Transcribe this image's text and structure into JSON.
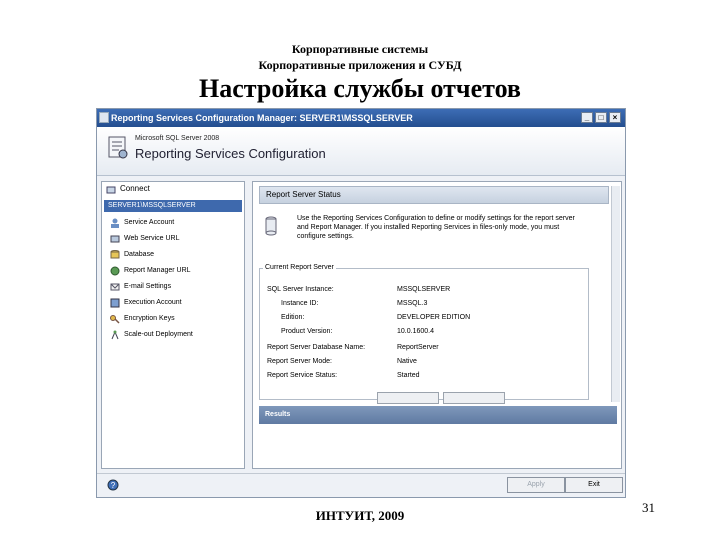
{
  "slide": {
    "header_line1": "Корпоративные системы",
    "header_line2": "Корпоративные приложения и СУБД",
    "title": "Настройка службы отчетов",
    "footer": "ИНТУИТ, 2009",
    "page_number": "31"
  },
  "window": {
    "title": "Reporting Services Configuration Manager: SERVER1\\MSSQLSERVER",
    "controls": [
      "_",
      "□",
      "×"
    ]
  },
  "banner": {
    "subtitle": "Microsoft SQL Server 2008",
    "title": "Reporting Services Configuration"
  },
  "sidebar": {
    "connect_label": "Connect",
    "server_label": "SERVER1\\MSSQLSERVER",
    "items": [
      {
        "label": "Service Account",
        "icon": "service-account-icon"
      },
      {
        "label": "Web Service URL",
        "icon": "web-service-icon"
      },
      {
        "label": "Database",
        "icon": "database-icon"
      },
      {
        "label": "Report Manager URL",
        "icon": "globe-icon"
      },
      {
        "label": "E-mail Settings",
        "icon": "email-icon"
      },
      {
        "label": "Execution Account",
        "icon": "execution-account-icon"
      },
      {
        "label": "Encryption Keys",
        "icon": "key-icon"
      },
      {
        "label": "Scale-out Deployment",
        "icon": "scale-out-icon"
      }
    ]
  },
  "status": {
    "header": "Report Server Status",
    "description": "Use the Reporting Services Configuration to define or modify settings for the report server and Report Manager. If you installed Reporting Services in files-only mode, you must configure settings.",
    "group_title": "Current Report Server",
    "fields": [
      {
        "label": "SQL Server Instance:",
        "value": "MSSQLSERVER",
        "indent": false
      },
      {
        "label": "Instance ID:",
        "value": "MSSQL.3",
        "indent": true
      },
      {
        "label": "Edition:",
        "value": "DEVELOPER EDITION",
        "indent": true
      },
      {
        "label": "Product Version:",
        "value": "10.0.1600.4",
        "indent": true
      },
      {
        "label": "Report Server Database Name:",
        "value": "ReportServer",
        "indent": false
      },
      {
        "label": "Report Server Mode:",
        "value": "Native",
        "indent": false
      },
      {
        "label": "Report Service Status:",
        "value": "Started",
        "indent": false
      }
    ]
  },
  "results": {
    "header": "Results"
  },
  "footer_buttons": {
    "apply": "Apply",
    "exit": "Exit"
  },
  "colors": {
    "titlebar": "#2f5c9f",
    "selection": "#3e69ad",
    "results_bar": "#6f89ae"
  }
}
